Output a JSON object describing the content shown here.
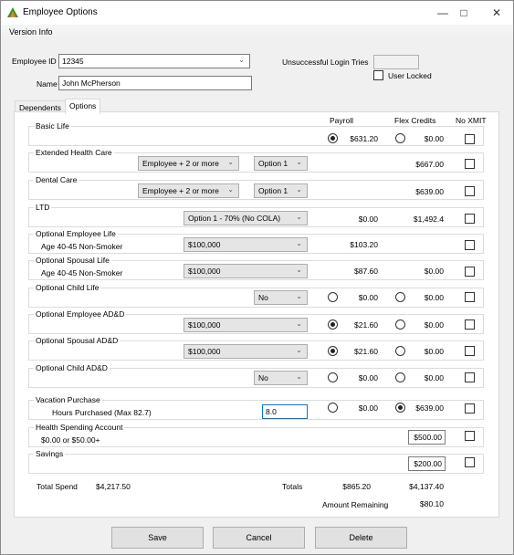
{
  "window": {
    "title": "Employee Options",
    "icon": "app-tree-icon"
  },
  "menu": {
    "items": [
      "Version Info"
    ]
  },
  "employee": {
    "id_label": "Employee ID",
    "id_value": "12345",
    "name_label": "Name",
    "name_value": "John McPherson",
    "login_tries_label": "Unsuccessful Login Tries",
    "login_tries_value": "",
    "user_locked_label": "User Locked",
    "user_locked": false
  },
  "tabs": [
    {
      "label": "Dependents",
      "active": false
    },
    {
      "label": "Options",
      "active": true
    }
  ],
  "columns": {
    "payroll": "Payroll",
    "flex": "Flex Credits",
    "noxmit": "No XMIT"
  },
  "benefits": [
    {
      "name": "Basic Life",
      "payroll": "$631.20",
      "flex": "$0.00",
      "payroll_selected": true,
      "flex_selected": false
    },
    {
      "name": "Extended Health Care",
      "coverage": "Employee + 2 or more",
      "option": "Option 1",
      "flex": "$667.00"
    },
    {
      "name": "Dental Care",
      "coverage": "Employee + 2 or more",
      "option": "Option 1",
      "flex": "$639.00"
    },
    {
      "name": "LTD",
      "plan": "Option 1 - 70% (No COLA)",
      "payroll": "$0.00",
      "flex": "$1,492.4"
    },
    {
      "name": "Optional Employee Life",
      "sub": "Age 40-45 Non-Smoker",
      "amount": "$100,000",
      "payroll": "$103.20"
    },
    {
      "name": "Optional Spousal Life",
      "sub": "Age 40-45 Non-Smoker",
      "amount": "$100,000",
      "payroll": "$87.60",
      "flex": "$0.00"
    },
    {
      "name": "Optional Child Life",
      "choice": "No",
      "payroll": "$0.00",
      "flex": "$0.00",
      "payroll_selected": false,
      "flex_selected": false
    },
    {
      "name": "Optional Employee AD&D",
      "amount": "$100,000",
      "payroll": "$21.60",
      "flex": "$0.00",
      "payroll_selected": true,
      "flex_selected": false
    },
    {
      "name": "Optional Spousal AD&D",
      "amount": "$100,000",
      "payroll": "$21.60",
      "flex": "$0.00",
      "payroll_selected": true,
      "flex_selected": false
    },
    {
      "name": "Optional Child AD&D",
      "choice": "No",
      "payroll": "$0.00",
      "flex": "$0.00",
      "payroll_selected": false,
      "flex_selected": false
    },
    {
      "name": "Vacation Purchase",
      "sub": "Hours Purchased (Max 82.7)",
      "hours": "8.0",
      "payroll": "$0.00",
      "flex": "$639.00",
      "payroll_selected": false,
      "flex_selected": true
    },
    {
      "name": "Health Spending Account",
      "sub": "$0.00 or $50.00+",
      "flex": "$500.00"
    },
    {
      "name": "Savings",
      "flex": "$200.00"
    }
  ],
  "summary": {
    "total_spend_label": "Total Spend",
    "total_spend": "$4,217.50",
    "totals_label": "Totals",
    "totals_payroll": "$865.20",
    "totals_flex": "$4,137.40",
    "remaining_label": "Amount Remaining",
    "remaining": "$80.10"
  },
  "buttons": {
    "save": "Save",
    "cancel": "Cancel",
    "delete": "Delete"
  }
}
